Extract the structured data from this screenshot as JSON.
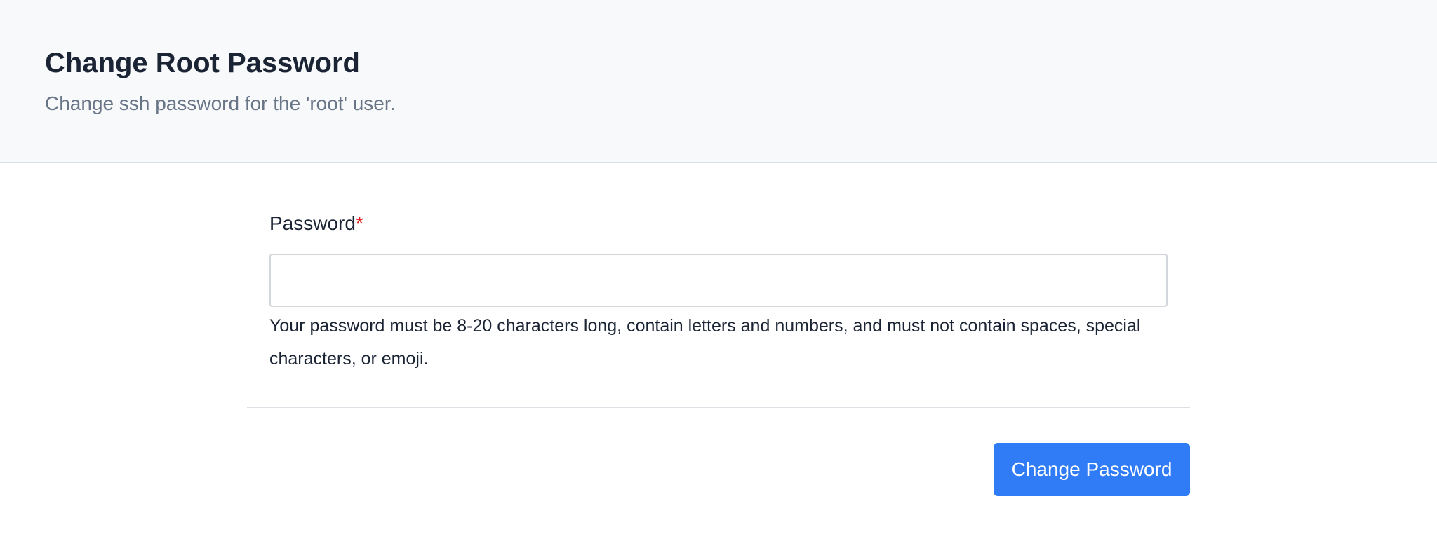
{
  "header": {
    "title": "Change Root Password",
    "subtitle": "Change ssh password for the 'root' user."
  },
  "form": {
    "password_label": "Password",
    "required_mark": "*",
    "password_value": "",
    "help_text": "Your password must be 8-20 characters long, contain letters and numbers, and must not contain spaces, special characters, or emoji.",
    "submit_label": "Change Password"
  },
  "colors": {
    "accent": "#2f7cf6",
    "required": "#e02424",
    "header_bg": "#f8f9fb"
  }
}
